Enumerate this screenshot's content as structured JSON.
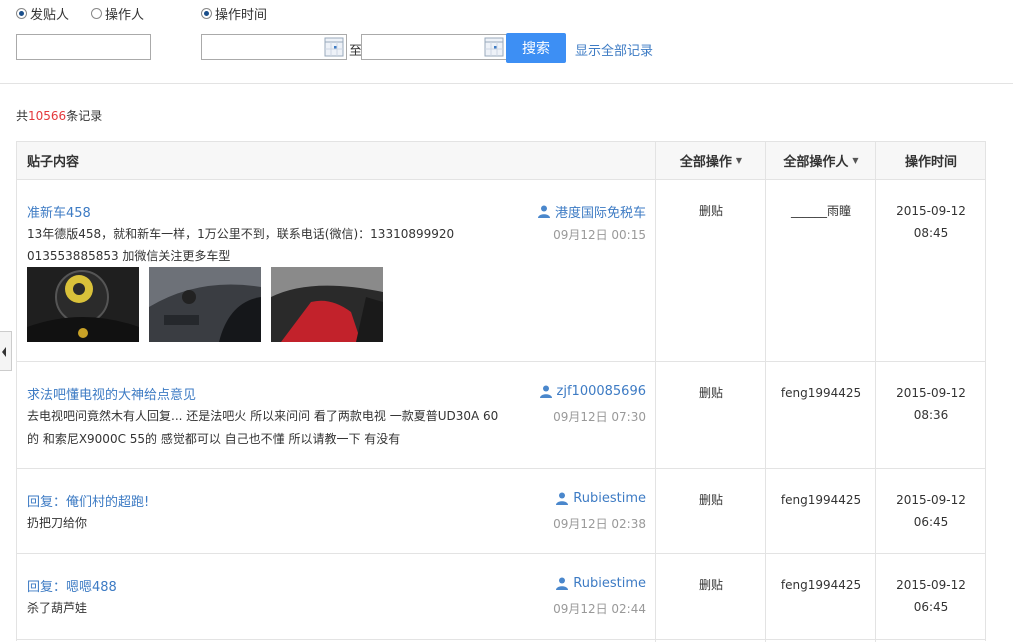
{
  "filters": {
    "radios": [
      {
        "label": "发贴人",
        "checked": true
      },
      {
        "label": "操作人",
        "checked": false
      },
      {
        "label": "操作时间",
        "checked": true
      }
    ],
    "to_label": "至",
    "search_label": "搜索",
    "show_all_label": "显示全部记录"
  },
  "summary": {
    "prefix": "共",
    "count": "10566",
    "suffix": "条记录"
  },
  "table": {
    "headers": {
      "content": "贴子内容",
      "action": "全部操作",
      "operator": "全部操作人",
      "time": "操作时间"
    },
    "rows": [
      {
        "title": "准新车458",
        "author": "港度国际免税车",
        "post_time": "09月12日 00:15",
        "lines": [
          "13年德版458，就和新车一样，1万公里不到，联系电话(微信)：13310899920",
          "013553885853 加微信关注更多车型"
        ],
        "action": "删贴",
        "operator": "______雨瞳",
        "date": "2015-09-12",
        "clock": "08:45"
      },
      {
        "title": "求法吧懂电视的大神给点意见",
        "author": "zjf100085696",
        "post_time": "09月12日 07:30",
        "lines": [
          "去电视吧问竟然木有人回复... 还是法吧火 所以来问问 看了两款电视 一款夏普UD30A 60",
          "的 和索尼X9000C 55的 感觉都可以 自己也不懂 所以请教一下 有没有"
        ],
        "action": "删贴",
        "operator": "feng1994425",
        "date": "2015-09-12",
        "clock": "08:36"
      },
      {
        "title": "回复：俺们村的超跑!",
        "author": "Rubiestime",
        "post_time": "09月12日 02:38",
        "lines": [
          "扔把刀给你"
        ],
        "action": "删贴",
        "operator": "feng1994425",
        "date": "2015-09-12",
        "clock": "06:45"
      },
      {
        "title": "回复：嗯嗯488",
        "author": "Rubiestime",
        "post_time": "09月12日 02:44",
        "lines": [
          "杀了葫芦娃"
        ],
        "action": "删贴",
        "operator": "feng1994425",
        "date": "2015-09-12",
        "clock": "06:45"
      }
    ]
  },
  "icons": {
    "user": "user-icon",
    "calendar": "calendar-icon",
    "collapse": "chevron-left-icon"
  },
  "colors": {
    "link": "#3d7bc4",
    "accent": "#3d8ff4",
    "count": "#e4393c"
  }
}
